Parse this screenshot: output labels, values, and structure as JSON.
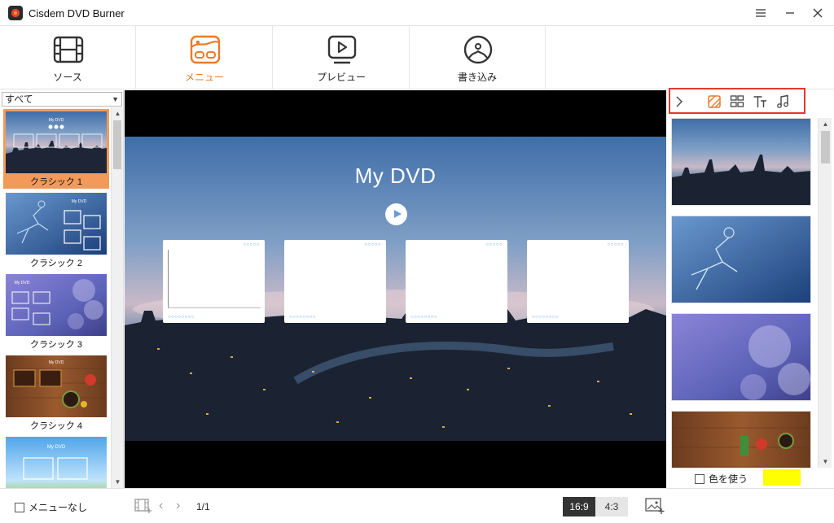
{
  "app": {
    "title": "Cisdem DVD Burner"
  },
  "toolbar": {
    "items": [
      {
        "label": "ソース",
        "icon": "film-strip-icon"
      },
      {
        "label": "メニュー",
        "icon": "menu-design-icon",
        "active": true
      },
      {
        "label": "プレビュー",
        "icon": "play-monitor-icon"
      },
      {
        "label": "書き込み",
        "icon": "disc-burn-icon"
      }
    ],
    "accent": "#EA7A2A"
  },
  "templates": {
    "filter": "すべて",
    "items": [
      {
        "name": "クラシック 1",
        "thumb_title": "My DVD",
        "selected": true
      },
      {
        "name": "クラシック 2",
        "thumb_title": "My DVD"
      },
      {
        "name": "クラシック 3",
        "thumb_title": "My DVD"
      },
      {
        "name": "クラシック 4",
        "thumb_title": "My DVD"
      },
      {
        "name": "",
        "thumb_title": "My DVD"
      }
    ]
  },
  "preview": {
    "title": "My DVD",
    "chapter_count": 4
  },
  "right_panel": {
    "tabs": [
      "chevron-right-icon",
      "background-icon",
      "layout-icon",
      "text-icon",
      "music-icon"
    ],
    "use_color_label": "色を使う",
    "color": "#FFFF00",
    "highlight": "#E03A2E"
  },
  "bottom": {
    "no_menu_label": "メニューなし",
    "page": "1/1",
    "ratio_active": "16:9",
    "ratio_other": "4:3"
  }
}
